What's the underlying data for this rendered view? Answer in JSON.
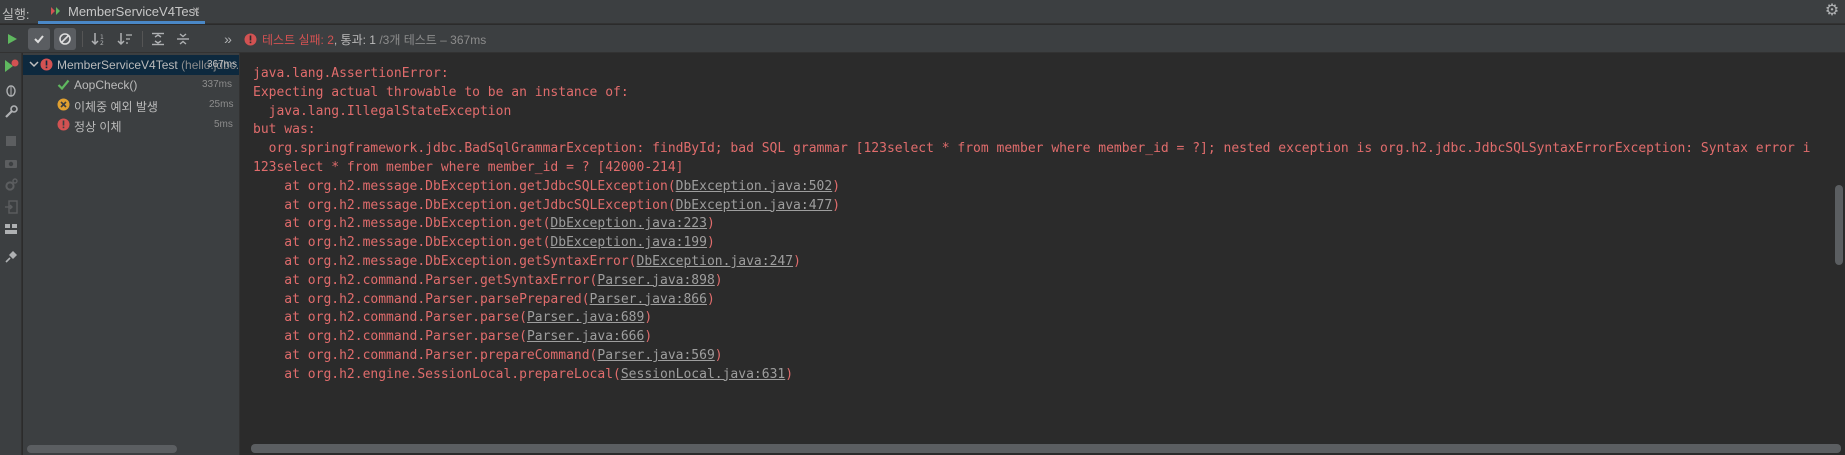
{
  "tabbar": {
    "run_label": "실행:",
    "tab_title": "MemberServiceV4Test",
    "close_glyph": "×",
    "gear_glyph": "⚙"
  },
  "toolbar": {
    "status_fail_label": "테스트 실패: 2",
    "status_sep": ", 통과: 1",
    "status_total": "/3개 테스트 – 367ms",
    "chevron": "»"
  },
  "tree": {
    "root": {
      "name": "MemberServiceV4Test",
      "package": "(hello.jdbc.service)",
      "duration": "367ms",
      "status": "failed"
    },
    "children": [
      {
        "name": "AopCheck()",
        "duration": "337ms",
        "status": "passed"
      },
      {
        "name": "이체중 예외 발생",
        "duration": "25ms",
        "status": "ignored-error"
      },
      {
        "name": "정상 이체",
        "duration": "5ms",
        "status": "failed"
      }
    ]
  },
  "console": {
    "lines": [
      {
        "text": "java.lang.AssertionError:"
      },
      {
        "text": "Expecting actual throwable to be an instance of:"
      },
      {
        "text": "  java.lang.IllegalStateException"
      },
      {
        "text": "but was:"
      },
      {
        "text": "  org.springframework.jdbc.BadSqlGrammarException: findById; bad SQL grammar [123select * from member where member_id = ?]; nested exception is org.h2.jdbc.JdbcSQLSyntaxErrorException: Syntax error i"
      },
      {
        "text": "123select * from member where member_id = ? [42000-214]"
      },
      {
        "pre": "    at org.h2.message.DbException.getJdbcSQLException(",
        "link": "DbException.java:502",
        "post": ")"
      },
      {
        "pre": "    at org.h2.message.DbException.getJdbcSQLException(",
        "link": "DbException.java:477",
        "post": ")"
      },
      {
        "pre": "    at org.h2.message.DbException.get(",
        "link": "DbException.java:223",
        "post": ")"
      },
      {
        "pre": "    at org.h2.message.DbException.get(",
        "link": "DbException.java:199",
        "post": ")"
      },
      {
        "pre": "    at org.h2.message.DbException.getSyntaxError(",
        "link": "DbException.java:247",
        "post": ")"
      },
      {
        "pre": "    at org.h2.command.Parser.getSyntaxError(",
        "link": "Parser.java:898",
        "post": ")"
      },
      {
        "pre": "    at org.h2.command.Parser.parsePrepared(",
        "link": "Parser.java:866",
        "post": ")"
      },
      {
        "pre": "    at org.h2.command.Parser.parse(",
        "link": "Parser.java:689",
        "post": ")"
      },
      {
        "pre": "    at org.h2.command.Parser.parse(",
        "link": "Parser.java:666",
        "post": ")"
      },
      {
        "pre": "    at org.h2.command.Parser.prepareCommand(",
        "link": "Parser.java:569",
        "post": ")"
      },
      {
        "pre": "    at org.h2.engine.SessionLocal.prepareLocal(",
        "link": "SessionLocal.java:631",
        "post": ")"
      }
    ]
  },
  "colors": {
    "error_text": "#e06c6c",
    "fail_red": "#d25252",
    "pass_green": "#5fb85f",
    "ignored_orange": "#e0a030",
    "selection": "#0d293e"
  }
}
